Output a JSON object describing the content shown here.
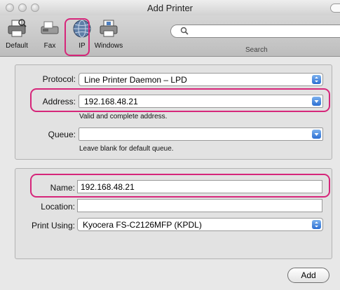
{
  "window": {
    "title": "Add Printer"
  },
  "toolbar": {
    "buttons": [
      {
        "label": "Default",
        "icon": "printer-icon"
      },
      {
        "label": "Fax",
        "icon": "fax-icon"
      },
      {
        "label": "IP",
        "icon": "globe-icon"
      },
      {
        "label": "Windows",
        "icon": "windows-printer-icon"
      }
    ],
    "search": {
      "label": "Search",
      "placeholder": ""
    }
  },
  "connection": {
    "protocol_label": "Protocol:",
    "protocol_value": "Line Printer Daemon – LPD",
    "address_label": "Address:",
    "address_value": "192.168.48.21",
    "address_hint": "Valid and complete address.",
    "queue_label": "Queue:",
    "queue_value": "",
    "queue_hint": "Leave blank for default queue."
  },
  "details": {
    "name_label": "Name:",
    "name_value": "192.168.48.21",
    "location_label": "Location:",
    "location_value": "",
    "print_using_label": "Print Using:",
    "print_using_value": "Kyocera FS-C2126MFP (KPDL)"
  },
  "actions": {
    "add_label": "Add"
  },
  "colors": {
    "highlight": "#d6267a",
    "popup_arrow": "#2c6fd3"
  }
}
